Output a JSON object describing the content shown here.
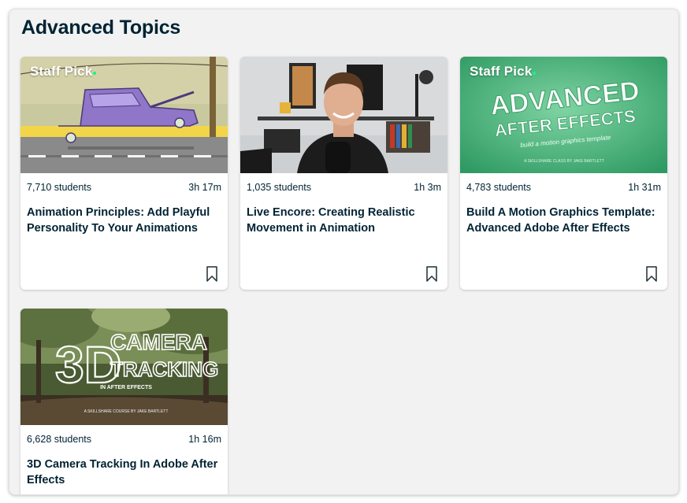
{
  "section": {
    "title": "Advanced Topics"
  },
  "badge": {
    "staff_pick": "Staff Pick"
  },
  "cards": [
    {
      "students": "7,710 students",
      "duration": "3h 17m",
      "title": "Animation Principles: Add Playful Personality To Your Animations",
      "staff_pick": true
    },
    {
      "students": "1,035 students",
      "duration": "1h 3m",
      "title": "Live Encore: Creating Realistic Movement in Animation",
      "staff_pick": false
    },
    {
      "students": "4,783 students",
      "duration": "1h 31m",
      "title": "Build A Motion Graphics Template: Advanced Adobe After Effects",
      "staff_pick": true,
      "thumb_text": {
        "line1": "ADVANCED",
        "line2": "AFTER EFFECTS",
        "line3": "build a motion graphics template",
        "line4": "A SKILLSHARE CLASS BY JAKE BARTLETT"
      }
    },
    {
      "students": "6,628 students",
      "duration": "1h 16m",
      "title": "3D Camera Tracking In Adobe After Effects",
      "staff_pick": false,
      "thumb_text": {
        "big": "3D",
        "line1": "CAMERA",
        "line2": "TRACKING",
        "line3": "IN AFTER EFFECTS",
        "line4": "A SKILLSHARE COURSE BY JAKE BARTLETT"
      }
    }
  ],
  "colors": {
    "accent": "#00ff84",
    "text": "#002333",
    "panel": "#f2f2f2"
  },
  "icons": {
    "bookmark": "bookmark-icon"
  }
}
